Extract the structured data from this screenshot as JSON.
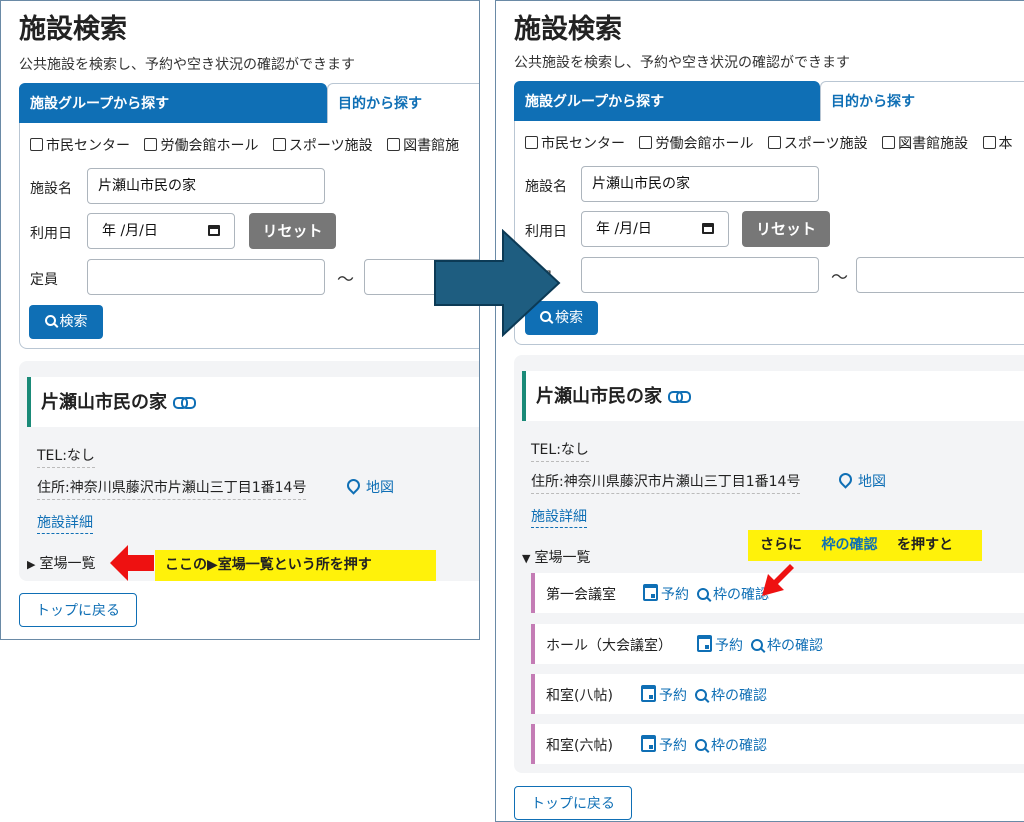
{
  "left": {
    "title": "施設検索",
    "subtitle": "公共施設を検索し、予約や空き状況の確認ができます",
    "tabs": [
      "施設グループから探す",
      "目的から探す"
    ],
    "checkboxes": [
      "市民センター",
      "労働会館ホール",
      "スポーツ施設",
      "図書館施"
    ],
    "form": {
      "name_label": "施設名",
      "name_value": "片瀬山市民の家",
      "date_label": "利用日",
      "date_value": "年 /月/日",
      "reset_label": "リセット",
      "capacity_label": "定員",
      "tilde": "～",
      "search_label": "検索"
    },
    "result": {
      "facility_name": "片瀬山市民の家",
      "tel": "TEL:なし",
      "address": "住所:神奈川県藤沢市片瀬山三丁目1番14号",
      "map_label": "地図",
      "detail_label": "施設詳細",
      "rooms_toggle": "室場一覧",
      "rooms_toggle_marker": "▶"
    },
    "top_button": "トップに戻る",
    "callout": "ここの▶室場一覧という所を押す"
  },
  "right": {
    "title": "施設検索",
    "subtitle": "公共施設を検索し、予約や空き状況の確認ができます",
    "tabs": [
      "施設グループから探す",
      "目的から探す"
    ],
    "checkboxes": [
      "市民センター",
      "労働会館ホール",
      "スポーツ施設",
      "図書館施設",
      "本"
    ],
    "form": {
      "name_label": "施設名",
      "name_value": "片瀬山市民の家",
      "date_label": "利用日",
      "date_value": "年 /月/日",
      "reset_label": "リセット",
      "capacity_label": "定員",
      "tilde": "～",
      "search_label": "検索"
    },
    "result": {
      "facility_name": "片瀬山市民の家",
      "tel": "TEL:なし",
      "address": "住所:神奈川県藤沢市片瀬山三丁目1番14号",
      "map_label": "地図",
      "detail_label": "施設詳細",
      "rooms_toggle": "室場一覧",
      "rooms_toggle_marker": "▼"
    },
    "rooms": [
      {
        "name": "第一会議室",
        "reserve": "予約",
        "check": "枠の確認"
      },
      {
        "name": "ホール（大会議室）",
        "reserve": "予約",
        "check": "枠の確認"
      },
      {
        "name": "和室(八帖)",
        "reserve": "予約",
        "check": "枠の確認"
      },
      {
        "name": "和室(六帖)",
        "reserve": "予約",
        "check": "枠の確認"
      }
    ],
    "top_button": "トップに戻る",
    "callout": {
      "before": "さらに",
      "highlight": "枠の確認",
      "after": "を押すと"
    }
  },
  "colors": {
    "primary_blue": "#0f6fb5",
    "facility_accent": "#1a8a78",
    "room_accent": "#c47cb5",
    "callout_yellow": "#fff20a",
    "pointer_red": "#ee1111",
    "big_arrow": "#1e5d80"
  }
}
